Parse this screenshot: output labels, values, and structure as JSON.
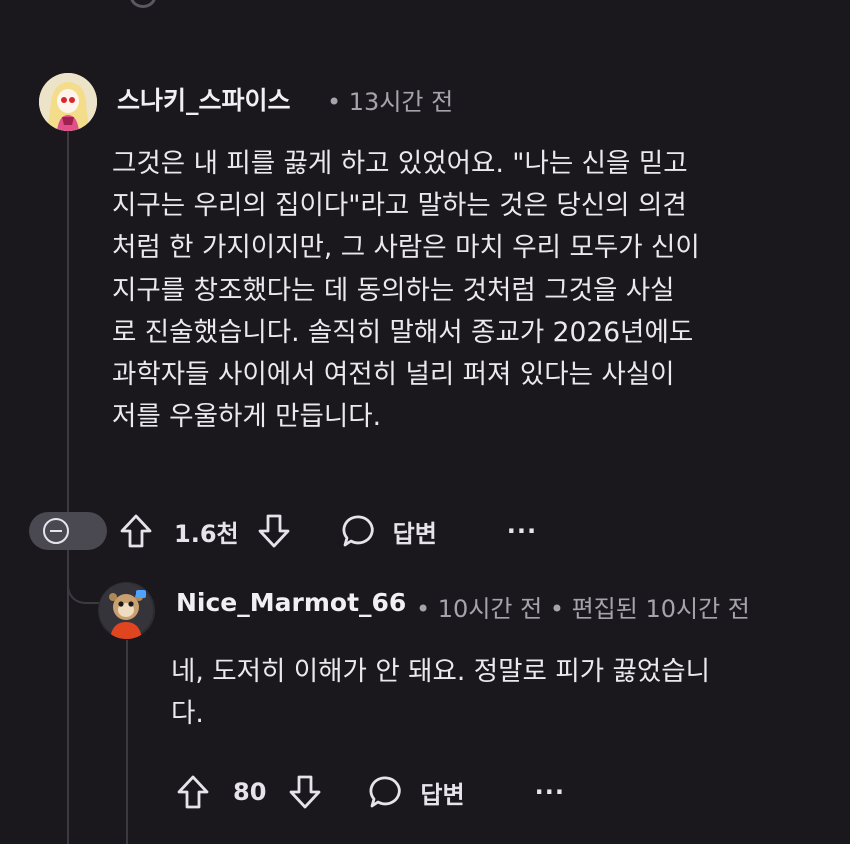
{
  "comment": {
    "author": "스나키_스파이스",
    "meta": "• 13시간 전",
    "body_lines": [
      "그것은 내 피를 끓게 하고 있었어요. \"나는 신을 믿고",
      "지구는 우리의 집이다\"라고 말하는 것은 당신의 의견",
      "처럼 한 가지이지만, 그 사람은 마치 우리 모두가 신이",
      "지구를 창조했다는 데 동의하는 것처럼 그것을 사실",
      "로 진술했습니다. 솔직히 말해서 종교가 2026년에도",
      "과학자들 사이에서 여전히 널리 퍼져 있다는 사실이",
      "저를 우울하게 만듭니다."
    ],
    "votes": "1.6천",
    "reply_label": "답변",
    "more_label": "···"
  },
  "reply": {
    "author": "Nice_Marmot_66",
    "meta": "• 10시간 전 • 편집된 10시간 전",
    "body_lines": [
      "네, 도저히 이해가 안 돼요. 정말로 피가 끓었습니",
      "다."
    ],
    "votes": "80",
    "reply_label": "답변",
    "more_label": "···"
  },
  "colors": {
    "background": "#1a181c",
    "text": "#ebe9ee",
    "meta": "#a7a3ad",
    "thread_line": "#3c3a40"
  }
}
